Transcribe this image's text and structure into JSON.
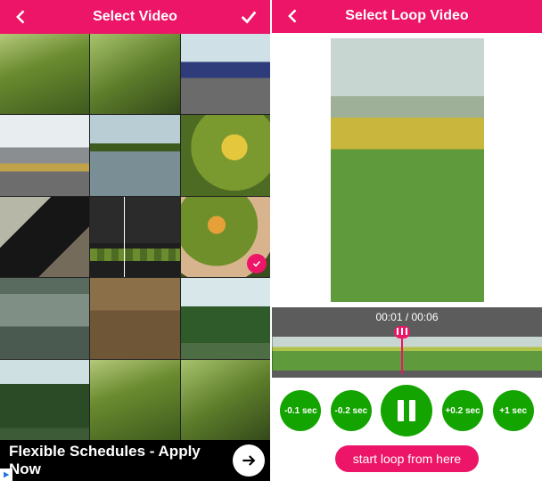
{
  "left": {
    "title": "Select Video",
    "selected_index": 8,
    "ad": {
      "text": "Flexible Schedules - Apply Now"
    }
  },
  "right": {
    "title": "Select Loop Video",
    "time": {
      "current": "00:01",
      "total": "00:06"
    },
    "time_display": "00:01 / 00:06",
    "controls": {
      "minus_1": "-0.1 sec",
      "minus_2": "-0.2 sec",
      "plus_2": "+0.2 sec",
      "plus_1": "+1 sec"
    },
    "start_label": "start loop from here"
  }
}
